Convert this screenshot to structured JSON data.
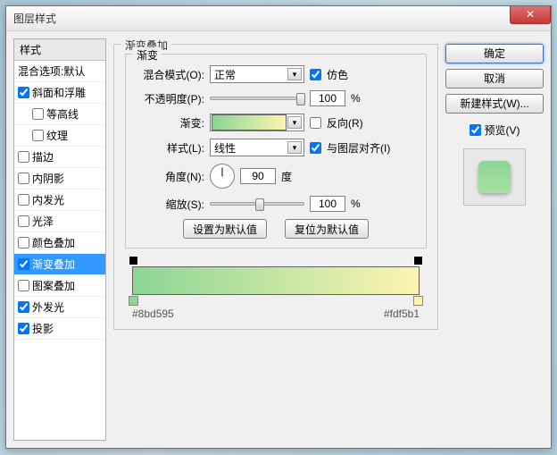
{
  "window": {
    "title": "图层样式"
  },
  "left": {
    "header": "样式",
    "blend_defaults": "混合选项:默认",
    "items": [
      {
        "label": "斜面和浮雕",
        "checked": true,
        "indent": false
      },
      {
        "label": "等高线",
        "checked": false,
        "indent": true
      },
      {
        "label": "纹理",
        "checked": false,
        "indent": true
      },
      {
        "label": "描边",
        "checked": false,
        "indent": false
      },
      {
        "label": "内阴影",
        "checked": false,
        "indent": false
      },
      {
        "label": "内发光",
        "checked": false,
        "indent": false
      },
      {
        "label": "光泽",
        "checked": false,
        "indent": false
      },
      {
        "label": "颜色叠加",
        "checked": false,
        "indent": false
      },
      {
        "label": "渐变叠加",
        "checked": true,
        "indent": false,
        "selected": true
      },
      {
        "label": "图案叠加",
        "checked": false,
        "indent": false
      },
      {
        "label": "外发光",
        "checked": true,
        "indent": false
      },
      {
        "label": "投影",
        "checked": true,
        "indent": false
      }
    ]
  },
  "center": {
    "group_title": "渐变叠加",
    "inner_title": "渐变",
    "blend_mode_label": "混合模式(O):",
    "blend_mode_value": "正常",
    "dither_label": "仿色",
    "dither_checked": true,
    "opacity_label": "不透明度(P):",
    "opacity_value": "100",
    "percent": "%",
    "gradient_label": "渐变:",
    "reverse_label": "反向(R)",
    "reverse_checked": false,
    "style_label": "样式(L):",
    "style_value": "线性",
    "align_label": "与图层对齐(I)",
    "align_checked": true,
    "angle_label": "角度(N):",
    "angle_value": "90",
    "degree": "度",
    "scale_label": "缩放(S):",
    "scale_value": "100",
    "reset_default": "设置为默认值",
    "revert_default": "复位为默认值",
    "color_left": "#8bd595",
    "color_right": "#fdf5b1"
  },
  "right": {
    "ok": "确定",
    "cancel": "取消",
    "new_style": "新建样式(W)...",
    "preview_label": "预览(V)",
    "preview_checked": true
  },
  "colors": {
    "accent": "#3399ff",
    "grad_start": "#8bd595",
    "grad_end": "#fdf5b1"
  }
}
